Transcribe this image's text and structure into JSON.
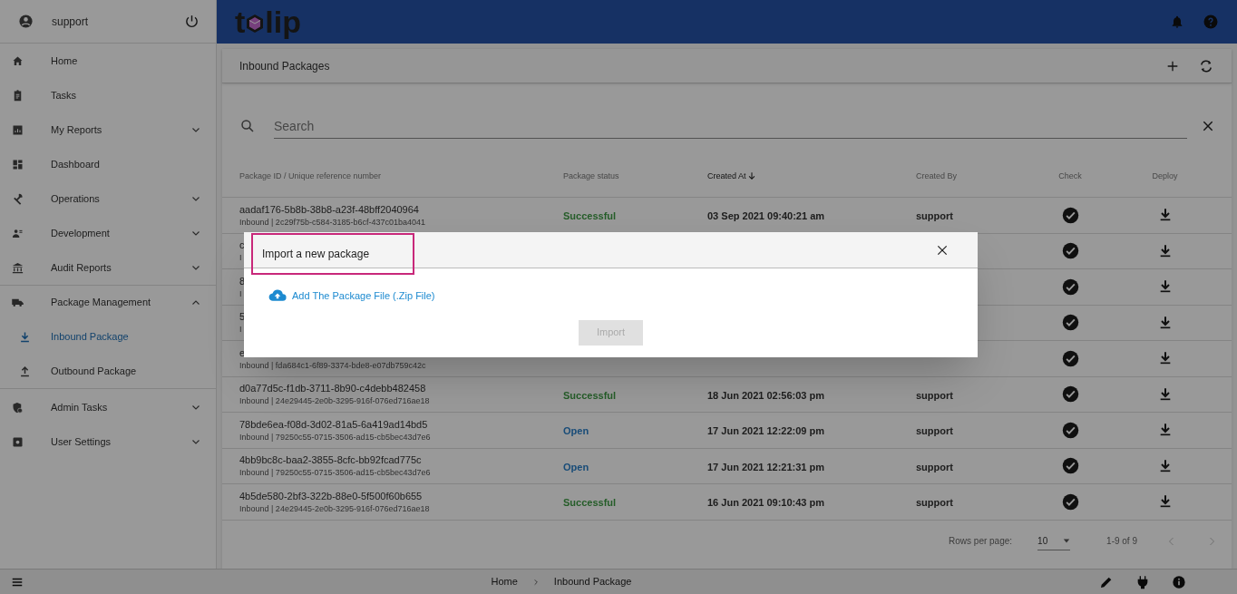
{
  "sidebar": {
    "user": "support",
    "items": [
      {
        "label": "Home",
        "kind": "link"
      },
      {
        "label": "Tasks",
        "kind": "link"
      },
      {
        "label": "My Reports",
        "kind": "group",
        "expanded": false
      },
      {
        "label": "Dashboard",
        "kind": "link"
      },
      {
        "label": "Operations",
        "kind": "group",
        "expanded": false
      },
      {
        "label": "Development",
        "kind": "group",
        "expanded": false
      },
      {
        "label": "Audit Reports",
        "kind": "group",
        "expanded": false
      },
      {
        "label": "Package Management",
        "kind": "group",
        "expanded": true,
        "children": [
          {
            "label": "Inbound Package",
            "selected": true
          },
          {
            "label": "Outbound Package",
            "selected": false
          }
        ]
      },
      {
        "label": "Admin Tasks",
        "kind": "group",
        "expanded": false
      },
      {
        "label": "User Settings",
        "kind": "group",
        "expanded": false
      }
    ]
  },
  "logo": {
    "before": "t",
    "after": "lip"
  },
  "panel": {
    "title": "Inbound Packages"
  },
  "search": {
    "placeholder": "Search"
  },
  "table": {
    "columns": [
      {
        "label": "Package ID / Unique reference number",
        "sorted": false
      },
      {
        "label": "Package status",
        "sorted": false
      },
      {
        "label": "Created At",
        "sorted": true
      },
      {
        "label": "Created By",
        "sorted": false
      },
      {
        "label": "Check",
        "sorted": false
      },
      {
        "label": "Deploy",
        "sorted": false
      }
    ],
    "rows": [
      {
        "id": "aadaf176-5b8b-38b8-a23f-48bff2040964",
        "ref": "Inbound | 2c29f75b-c584-3185-b6cf-437c01ba4041",
        "status": "Successful",
        "kind": "success",
        "created_at": "03 Sep 2021 09:40:21 am",
        "created_by": "support"
      },
      {
        "id": "c",
        "ref": "I"
      },
      {
        "id": "8",
        "ref": "I"
      },
      {
        "id": "5",
        "ref": "I"
      },
      {
        "id": "e",
        "ref": "Inbound | fda684c1-6f89-3374-bde8-e07db759c42c"
      },
      {
        "id": "d0a77d5c-f1db-3711-8b90-c4debb482458",
        "ref": "Inbound | 24e29445-2e0b-3295-916f-076ed716ae18",
        "status": "Successful",
        "kind": "success",
        "created_at": "18 Jun 2021 02:56:03 pm",
        "created_by": "support"
      },
      {
        "id": "78bde6ea-f08d-3d02-81a5-6a419ad14bd5",
        "ref": "Inbound | 79250c55-0715-3506-ad15-cb5bec43d7e6",
        "status": "Open",
        "kind": "open",
        "created_at": "17 Jun 2021 12:22:09 pm",
        "created_by": "support"
      },
      {
        "id": "4bb9bc8c-baa2-3855-8cfc-bb92fcad775c",
        "ref": "Inbound | 79250c55-0715-3506-ad15-cb5bec43d7e6",
        "status": "Open",
        "kind": "open",
        "created_at": "17 Jun 2021 12:21:31 pm",
        "created_by": "support"
      },
      {
        "id": "4b5de580-2bf3-322b-88e0-5f500f60b655",
        "ref": "Inbound | 24e29445-2e0b-3295-916f-076ed716ae18",
        "status": "Successful",
        "kind": "success",
        "created_at": "16 Jun 2021 09:10:43 pm",
        "created_by": "support"
      }
    ]
  },
  "pagination": {
    "rows_label": "Rows per page:",
    "rows_value": "10",
    "range": "1-9 of 9"
  },
  "breadcrumbs": [
    "Home",
    "Inbound Package"
  ],
  "dialog": {
    "title": "Import a new package",
    "add_file": "Add The Package File (.Zip File)",
    "import_button": {
      "label": "Import",
      "disabled": true
    }
  }
}
